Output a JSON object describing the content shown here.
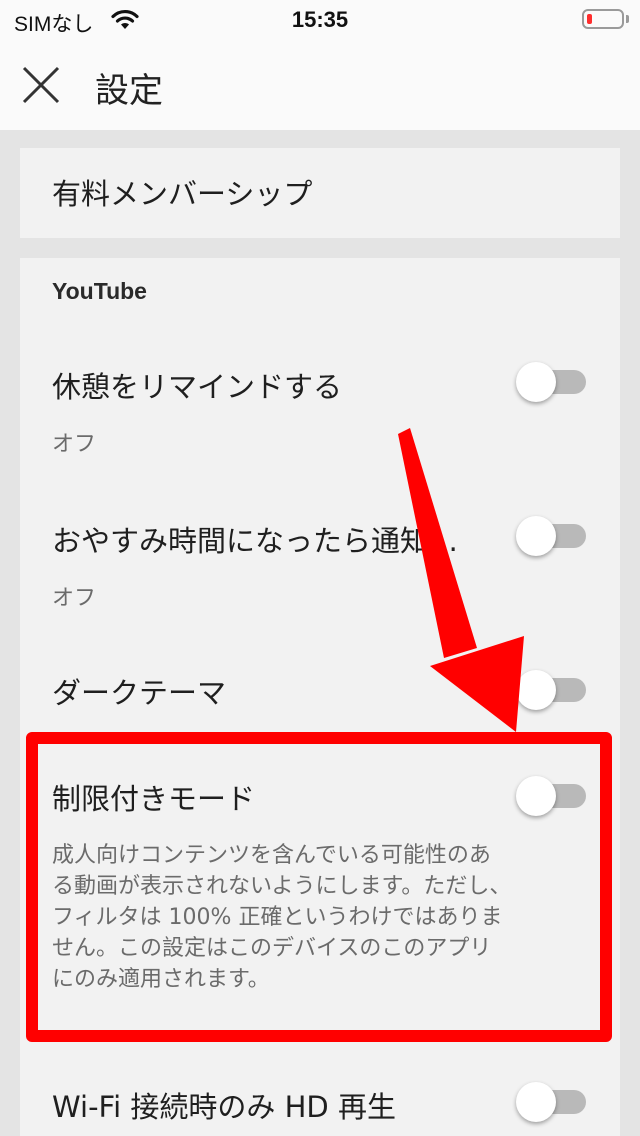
{
  "status_bar": {
    "carrier": "SIMなし",
    "time": "15:35",
    "battery_level": 0.15,
    "battery_color": "#ff2d2d"
  },
  "header": {
    "title": "設定"
  },
  "membership": {
    "label": "有料メンバーシップ"
  },
  "youtube_section": {
    "heading": "YouTube",
    "items": [
      {
        "title": "休憩をリマインドする",
        "subtitle": "オフ",
        "on": false
      },
      {
        "title": "おやすみ時間になったら通知…",
        "subtitle": "オフ",
        "on": false
      },
      {
        "title": "ダークテーマ",
        "on": false
      },
      {
        "title": "制限付きモード",
        "description": "成人向けコンテンツを含んでいる可能性のある動画が表示されないようにします。ただし、フィルタは 100% 正確というわけではありません。この設定はこのデバイスのこのアプリにのみ適用されます。",
        "on": false
      },
      {
        "title": "Wi-Fi 接続時のみ HD 再生",
        "on": false
      }
    ]
  },
  "colors": {
    "annotation": "#ff0000",
    "toggle_off_track": "#b9b9b9"
  }
}
